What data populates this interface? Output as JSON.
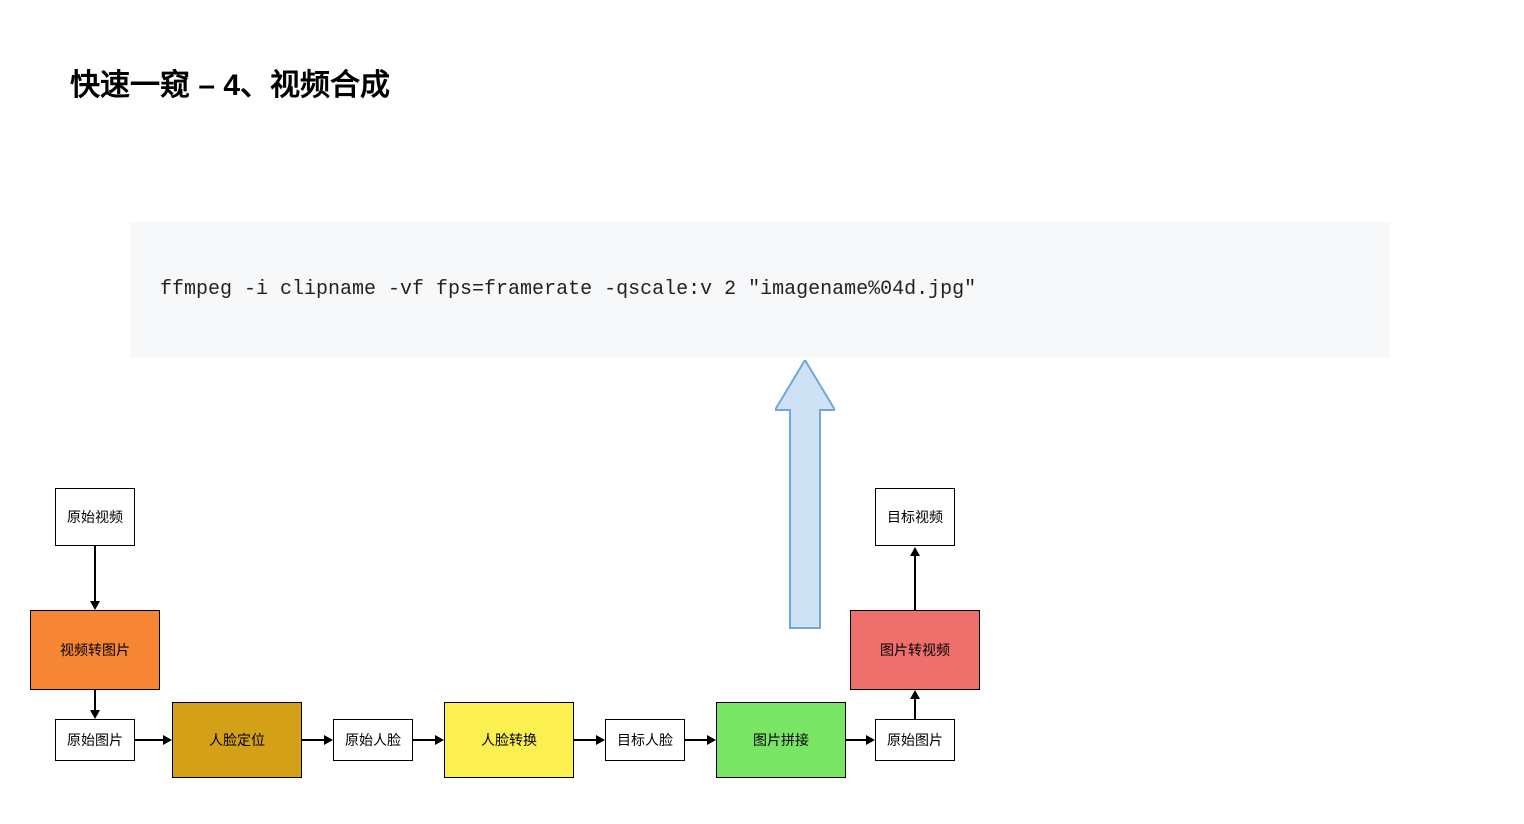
{
  "title": "快速一窥 – 4、视频合成",
  "code": "ffmpeg -i clipname -vf fps=framerate -qscale:v 2 \"imagename%04d.jpg\"",
  "nodes": {
    "source_video": "原始视频",
    "video_to_image": "视频转图片",
    "source_image_1": "原始图片",
    "face_locate": "人脸定位",
    "source_face": "原始人脸",
    "face_swap": "人脸转换",
    "target_face": "目标人脸",
    "image_stitch": "图片拼接",
    "source_image_2": "原始图片",
    "image_to_video": "图片转视频",
    "target_video": "目标视频"
  }
}
